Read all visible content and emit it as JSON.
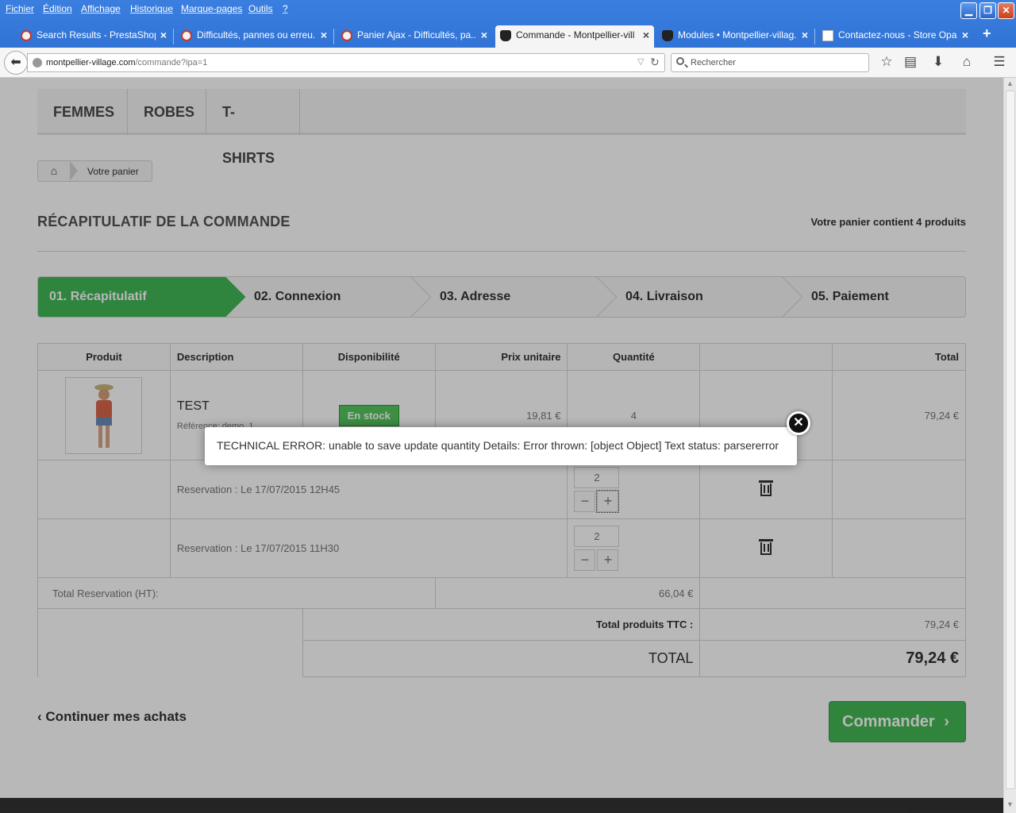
{
  "browser": {
    "menu": [
      "Fichier",
      "Édition",
      "Affichage",
      "Historique",
      "Marque-pages",
      "Outils",
      "?"
    ],
    "tabs": [
      {
        "label": "Search Results - PrestaShop"
      },
      {
        "label": "Difficultés, pannes ou erreu..."
      },
      {
        "label": "Panier Ajax - Difficultés, pa..."
      },
      {
        "label": "Commande - Montpellier-vill..."
      },
      {
        "label": "Modules • Montpellier-villag..."
      },
      {
        "label": "Contactez-nous - Store Opart"
      }
    ],
    "url_host": "montpellier-village.com",
    "url_path": "/commande?ipa=1",
    "search_placeholder": "Rechercher"
  },
  "nav": {
    "categories": [
      "FEMMES",
      "ROBES",
      "T-SHIRTS"
    ],
    "breadcrumb": "Votre panier"
  },
  "order": {
    "heading": "RÉCAPITULATIF DE LA COMMANDE",
    "cart_count": "Votre panier contient 4 produits",
    "steps": [
      "01. Récapitulatif",
      "02. Connexion",
      "03. Adresse",
      "04. Livraison",
      "05. Paiement"
    ],
    "columns": [
      "Produit",
      "Description",
      "Disponibilité",
      "Prix unitaire",
      "Quantité",
      "",
      "Total"
    ],
    "product": {
      "name": "TEST",
      "reference": "Référence: demo_1",
      "availability": "En stock",
      "unit_price": "19,81 €",
      "quantity": "4",
      "total": "79,24 €"
    },
    "reservations": [
      {
        "label": "Reservation :  Le 17/07/2015 12H45",
        "qty": "2"
      },
      {
        "label": "Reservation :  Le 17/07/2015 11H30",
        "qty": "2"
      }
    ],
    "total_reservation_label": "Total Reservation (HT):",
    "total_reservation_value": "66,04 €",
    "total_products_label": "Total produits TTC :",
    "total_products_value": "79,24 €",
    "total_label": "TOTAL",
    "total_value": "79,24 €",
    "continue_label": "Continuer mes achats",
    "checkout_label": "Commander"
  },
  "dialog": {
    "message": "TECHNICAL ERROR: unable to save update quantity Details: Error thrown: [object Object] Text status: parsererror"
  }
}
